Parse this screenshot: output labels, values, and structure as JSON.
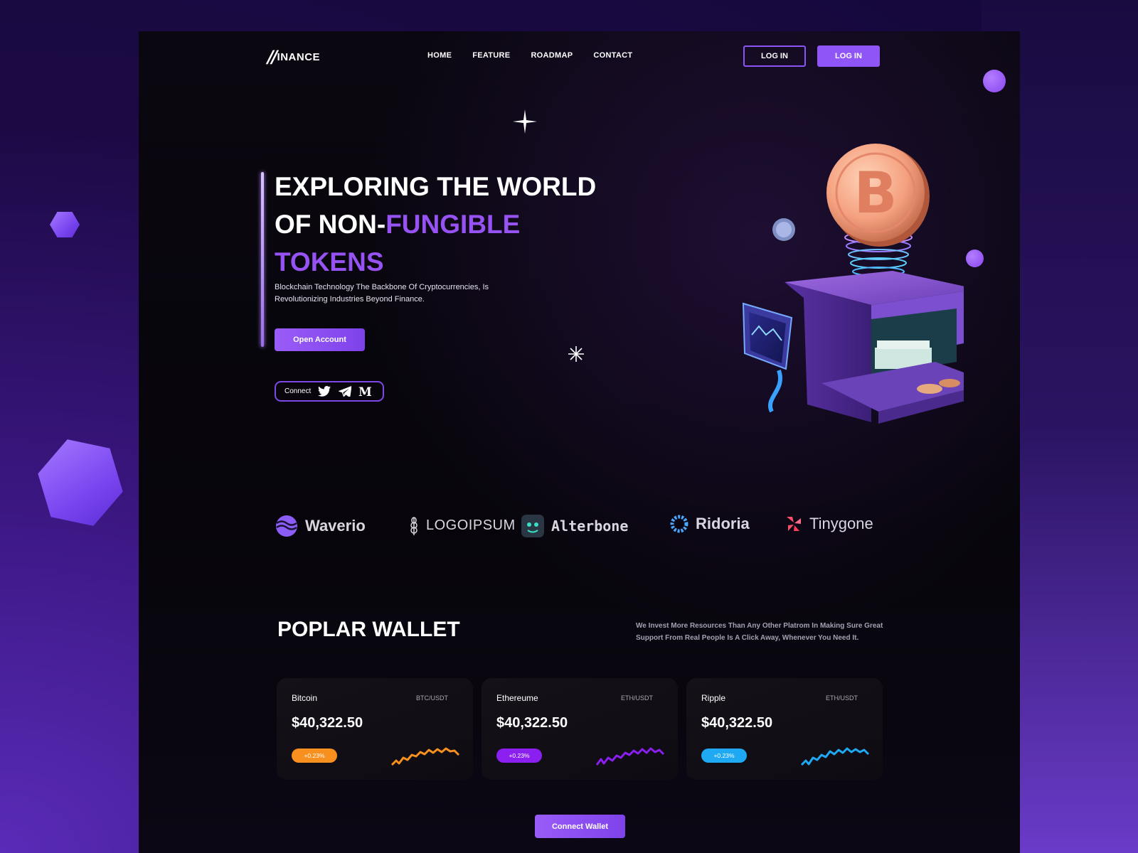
{
  "brand": {
    "logo_mark": "//",
    "logo_text": "INANCE"
  },
  "nav": {
    "items": [
      "HOME",
      "FEATURE",
      "ROADMAP",
      "CONTACT"
    ]
  },
  "header": {
    "login_outline": "LOG IN",
    "login_solid": "LOG IN"
  },
  "hero": {
    "title_line1": "EXPLORING THE WORLD",
    "title_line2_plain": "OF NON-",
    "title_line2_accent": "FUNGIBLE",
    "title_line3_accent": "TOKENS",
    "subtitle": "Blockchain Technology The Backbone Of Cryptocurrencies, Is Revolutionizing Industries Beyond Finance.",
    "cta": "Open Account",
    "connect_label": "Connect",
    "social_icons": [
      "twitter-icon",
      "telegram-icon",
      "medium-icon"
    ]
  },
  "partners": [
    {
      "name": "Waverio",
      "icon": "wave-logo-icon"
    },
    {
      "name": "LOGOIPSUM",
      "icon": "wheat-logo-icon"
    },
    {
      "name": "Alterbone",
      "icon": "face-logo-icon"
    },
    {
      "name": "Ridoria",
      "icon": "ring-logo-icon"
    },
    {
      "name": "Tinygone",
      "icon": "petal-logo-icon"
    }
  ],
  "wallet": {
    "title": "POPLAR WALLET",
    "description": "We Invest More Resources Than Any Other Platrom In Making Sure Great Support From Real People Is A Click Away, Whenever You Need It.",
    "cards": [
      {
        "name": "Bitcoin",
        "pair": "BTC/USDT",
        "price": "$40,322.50",
        "change": "+0.23%",
        "color": "#f7901e"
      },
      {
        "name": "Ethereume",
        "pair": "ETH/USDT",
        "price": "$40,322.50",
        "change": "+0.23%",
        "color": "#8a1ff0"
      },
      {
        "name": "Ripple",
        "pair": "ETH/USDT",
        "price": "$40,322.50",
        "change": "+0.23%",
        "color": "#1fa9f2"
      }
    ],
    "cta": "Connect Wallet"
  },
  "colors": {
    "accent": "#8f55f7",
    "background": "#07050b"
  }
}
